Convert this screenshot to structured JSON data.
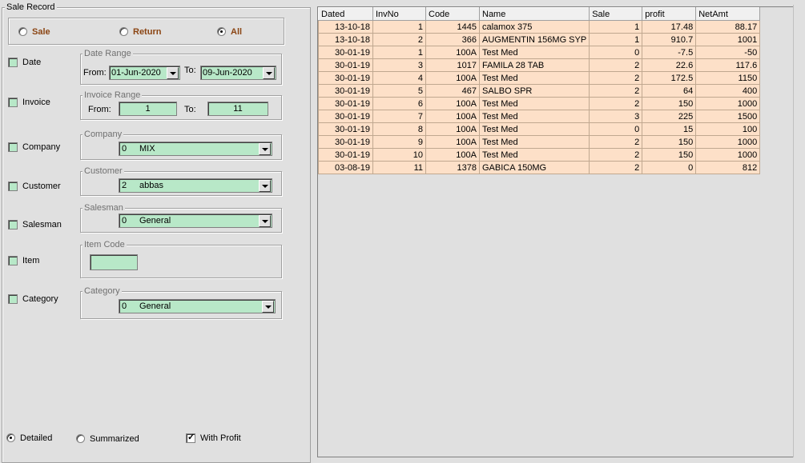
{
  "window": {
    "title": "Sale Record"
  },
  "mode_radios": [
    {
      "label": "Sale",
      "selected": false
    },
    {
      "label": "Return",
      "selected": false
    },
    {
      "label": "All",
      "selected": true
    }
  ],
  "filters": {
    "date": {
      "label": "Date",
      "checked": false,
      "group": "Date Range",
      "from_label": "From:",
      "from_value": "01-Jun-2020",
      "to_label": "To:",
      "to_value": "09-Jun-2020"
    },
    "invoice": {
      "label": "Invoice",
      "checked": false,
      "group": "Invoice Range",
      "from_label": "From:",
      "from_value": "1",
      "to_label": "To:",
      "to_value": "11"
    },
    "company": {
      "label": "Company",
      "checked": false,
      "group": "Company",
      "code": "0",
      "name": "MIX"
    },
    "customer": {
      "label": "Customer",
      "checked": false,
      "group": "Customer",
      "code": "2",
      "name": "abbas"
    },
    "salesman": {
      "label": "Salesman",
      "checked": false,
      "group": "Salesman",
      "code": "0",
      "name": "General"
    },
    "item": {
      "label": "Item",
      "checked": false,
      "group": "Item Code",
      "value": ""
    },
    "category": {
      "label": "Category",
      "checked": false,
      "group": "Category",
      "code": "0",
      "name": "General"
    }
  },
  "footer": {
    "detailed": {
      "label": "Detailed",
      "selected": true
    },
    "summarized": {
      "label": "Summarized",
      "selected": false
    },
    "with_profit": {
      "label": "With Profit",
      "checked": true
    }
  },
  "grid": {
    "columns": [
      "Dated",
      "InvNo",
      "Code",
      "Name",
      "Sale",
      "profit",
      "NetAmt"
    ],
    "rows": [
      [
        "13-10-18",
        "1",
        "1445",
        "calamox 375",
        "1",
        "17.48",
        "88.17"
      ],
      [
        "13-10-18",
        "2",
        "366",
        "AUGMENTIN 156MG SYP",
        "1",
        "910.7",
        "1001"
      ],
      [
        "30-01-19",
        "1",
        "100A",
        "Test Med",
        "0",
        "-7.5",
        "-50"
      ],
      [
        "30-01-19",
        "3",
        "1017",
        "FAMILA 28 TAB",
        "2",
        "22.6",
        "117.6"
      ],
      [
        "30-01-19",
        "4",
        "100A",
        "Test Med",
        "2",
        "172.5",
        "1150"
      ],
      [
        "30-01-19",
        "5",
        "467",
        "SALBO SPR",
        "2",
        "64",
        "400"
      ],
      [
        "30-01-19",
        "6",
        "100A",
        "Test Med",
        "2",
        "150",
        "1000"
      ],
      [
        "30-01-19",
        "7",
        "100A",
        "Test Med",
        "3",
        "225",
        "1500"
      ],
      [
        "30-01-19",
        "8",
        "100A",
        "Test Med",
        "0",
        "15",
        "100"
      ],
      [
        "30-01-19",
        "9",
        "100A",
        "Test Med",
        "2",
        "150",
        "1000"
      ],
      [
        "30-01-19",
        "10",
        "100A",
        "Test Med",
        "2",
        "150",
        "1000"
      ],
      [
        "03-08-19",
        "11",
        "1378",
        "GABICA 150MG",
        "2",
        "0",
        "812"
      ]
    ]
  }
}
